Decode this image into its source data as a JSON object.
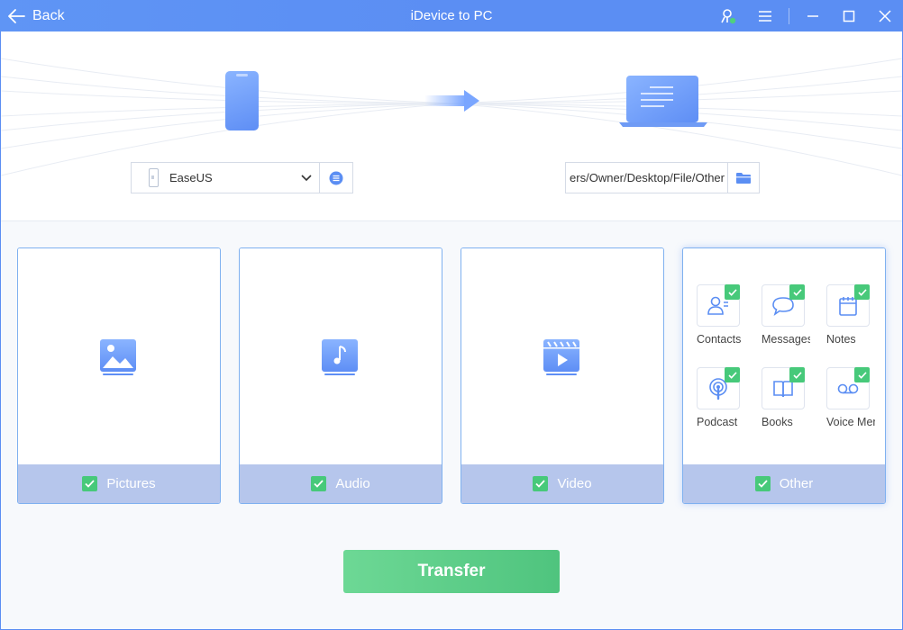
{
  "titlebar": {
    "back_label": "Back",
    "title": "iDevice to PC",
    "icons": [
      "account-status-icon",
      "menu-icon",
      "minimize-icon",
      "maximize-icon",
      "close-icon"
    ]
  },
  "source": {
    "device_name": "EaseUS"
  },
  "destination": {
    "path": "ers/Owner/Desktop/File/Other"
  },
  "categories": [
    {
      "label": "Pictures",
      "icon": "picture-icon",
      "checked": true
    },
    {
      "label": "Audio",
      "icon": "music-icon",
      "checked": true
    },
    {
      "label": "Video",
      "icon": "video-icon",
      "checked": true
    },
    {
      "label": "Other",
      "icon": "other-icon",
      "checked": true
    }
  ],
  "other_items": [
    {
      "label": "Contacts",
      "icon": "contacts-icon",
      "checked": true
    },
    {
      "label": "Messages",
      "icon": "messages-icon",
      "checked": true
    },
    {
      "label": "Notes",
      "icon": "notes-icon",
      "checked": true
    },
    {
      "label": "Podcast",
      "icon": "podcast-icon",
      "checked": true
    },
    {
      "label": "Books",
      "icon": "books-icon",
      "checked": true
    },
    {
      "label": "Voice Memos",
      "icon": "voice-memos-icon",
      "checked": true
    }
  ],
  "actions": {
    "transfer_label": "Transfer"
  },
  "colors": {
    "accent": "#5b8ef3",
    "success": "#47c97a",
    "card_footer": "#b6c6ec"
  }
}
